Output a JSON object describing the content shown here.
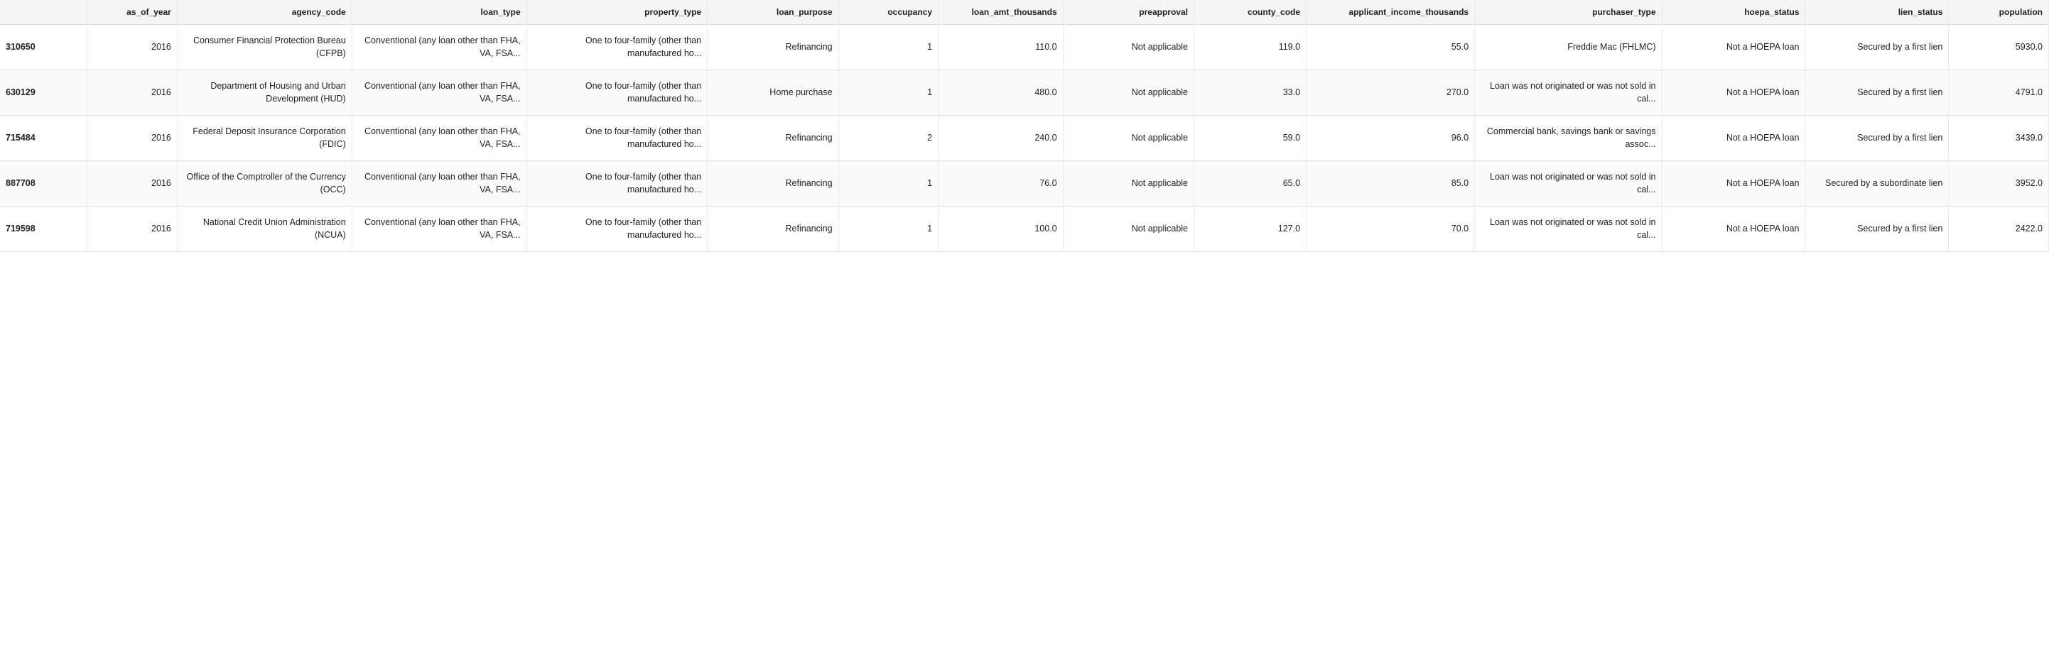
{
  "table": {
    "columns": [
      {
        "key": "index",
        "label": "",
        "class": "col-index"
      },
      {
        "key": "as_of_year",
        "label": "as_of_year",
        "class": "col-year"
      },
      {
        "key": "agency_code",
        "label": "agency_code",
        "class": "col-agency"
      },
      {
        "key": "loan_type",
        "label": "loan_type",
        "class": "col-loan-type"
      },
      {
        "key": "property_type",
        "label": "property_type",
        "class": "col-prop-type"
      },
      {
        "key": "loan_purpose",
        "label": "loan_purpose",
        "class": "col-purpose"
      },
      {
        "key": "occupancy",
        "label": "occupancy",
        "class": "col-occupancy"
      },
      {
        "key": "loan_amt_thousands",
        "label": "loan_amt_thousands",
        "class": "col-amt"
      },
      {
        "key": "preapproval",
        "label": "preapproval",
        "class": "col-preapproval"
      },
      {
        "key": "county_code",
        "label": "county_code",
        "class": "col-county"
      },
      {
        "key": "applicant_income_thousands",
        "label": "applicant_income_thousands",
        "class": "col-income"
      },
      {
        "key": "purchaser_type",
        "label": "purchaser_type",
        "class": "col-purchaser"
      },
      {
        "key": "hoepa_status",
        "label": "hoepa_status",
        "class": "col-hoepa"
      },
      {
        "key": "lien_status",
        "label": "lien_status",
        "class": "col-lien"
      },
      {
        "key": "population",
        "label": "population",
        "class": "col-population"
      }
    ],
    "rows": [
      {
        "index": "310650",
        "as_of_year": "2016",
        "agency_code": "Consumer Financial Protection Bureau (CFPB)",
        "loan_type": "Conventional (any loan other than FHA, VA, FSA...",
        "property_type": "One to four-family (other than manufactured ho...",
        "loan_purpose": "Refinancing",
        "occupancy": "1",
        "loan_amt_thousands": "110.0",
        "preapproval": "Not applicable",
        "county_code": "119.0",
        "applicant_income_thousands": "55.0",
        "purchaser_type": "Freddie Mac (FHLMC)",
        "hoepa_status": "Not a HOEPA loan",
        "lien_status": "Secured by a first lien",
        "population": "5930.0"
      },
      {
        "index": "630129",
        "as_of_year": "2016",
        "agency_code": "Department of Housing and Urban Development (HUD)",
        "loan_type": "Conventional (any loan other than FHA, VA, FSA...",
        "property_type": "One to four-family (other than manufactured ho...",
        "loan_purpose": "Home purchase",
        "occupancy": "1",
        "loan_amt_thousands": "480.0",
        "preapproval": "Not applicable",
        "county_code": "33.0",
        "applicant_income_thousands": "270.0",
        "purchaser_type": "Loan was not originated or was not sold in cal...",
        "hoepa_status": "Not a HOEPA loan",
        "lien_status": "Secured by a first lien",
        "population": "4791.0"
      },
      {
        "index": "715484",
        "as_of_year": "2016",
        "agency_code": "Federal Deposit Insurance Corporation (FDIC)",
        "loan_type": "Conventional (any loan other than FHA, VA, FSA...",
        "property_type": "One to four-family (other than manufactured ho...",
        "loan_purpose": "Refinancing",
        "occupancy": "2",
        "loan_amt_thousands": "240.0",
        "preapproval": "Not applicable",
        "county_code": "59.0",
        "applicant_income_thousands": "96.0",
        "purchaser_type": "Commercial bank, savings bank or savings assoc...",
        "hoepa_status": "Not a HOEPA loan",
        "lien_status": "Secured by a first lien",
        "population": "3439.0"
      },
      {
        "index": "887708",
        "as_of_year": "2016",
        "agency_code": "Office of the Comptroller of the Currency (OCC)",
        "loan_type": "Conventional (any loan other than FHA, VA, FSA...",
        "property_type": "One to four-family (other than manufactured ho...",
        "loan_purpose": "Refinancing",
        "occupancy": "1",
        "loan_amt_thousands": "76.0",
        "preapproval": "Not applicable",
        "county_code": "65.0",
        "applicant_income_thousands": "85.0",
        "purchaser_type": "Loan was not originated or was not sold in cal...",
        "hoepa_status": "Not a HOEPA loan",
        "lien_status": "Secured by a subordinate lien",
        "population": "3952.0"
      },
      {
        "index": "719598",
        "as_of_year": "2016",
        "agency_code": "National Credit Union Administration (NCUA)",
        "loan_type": "Conventional (any loan other than FHA, VA, FSA...",
        "property_type": "One to four-family (other than manufactured ho...",
        "loan_purpose": "Refinancing",
        "occupancy": "1",
        "loan_amt_thousands": "100.0",
        "preapproval": "Not applicable",
        "county_code": "127.0",
        "applicant_income_thousands": "70.0",
        "purchaser_type": "Loan was not originated or was not sold in cal...",
        "hoepa_status": "Not a HOEPA loan",
        "lien_status": "Secured by a first lien",
        "population": "2422.0"
      }
    ]
  }
}
